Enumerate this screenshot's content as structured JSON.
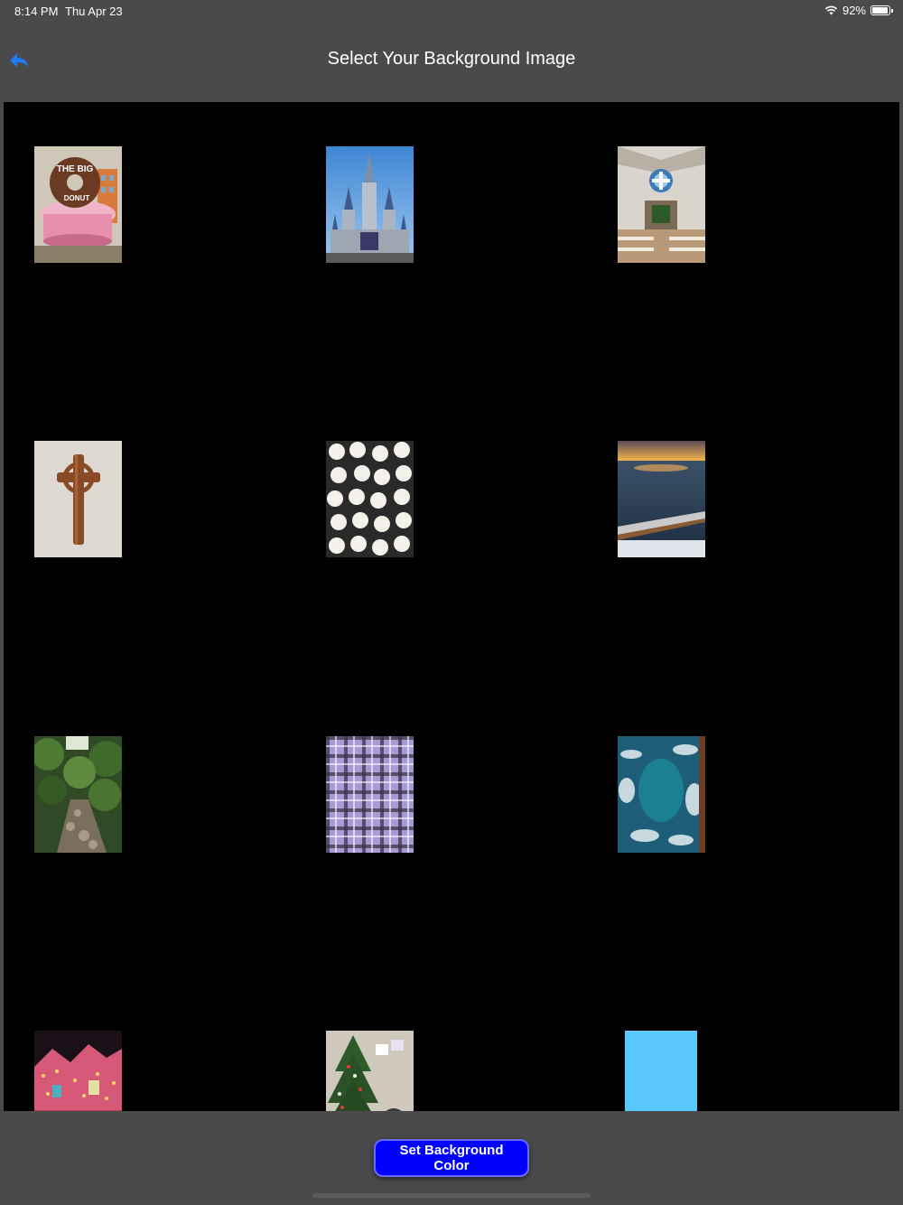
{
  "status_bar": {
    "time": "8:14 PM",
    "date": "Thu Apr 23",
    "battery": "92%",
    "battery_level": 0.92,
    "wifi_icon": "wifi-icon"
  },
  "nav": {
    "title": "Select Your Background Image",
    "back_icon": "back-arrow-icon",
    "accent_color": "#1e7cf2"
  },
  "gallery": {
    "images": [
      {
        "id": "donut",
        "description_icon": "photo-thumbnail"
      },
      {
        "id": "castle"
      },
      {
        "id": "church"
      },
      {
        "id": "cross"
      },
      {
        "id": "flowers"
      },
      {
        "id": "sunset"
      },
      {
        "id": "jungle"
      },
      {
        "id": "plaid"
      },
      {
        "id": "ocean"
      },
      {
        "id": "small-world"
      },
      {
        "id": "tree"
      },
      {
        "id": "sky-swatch"
      }
    ]
  },
  "footer": {
    "set_color_label": "Set Background Color",
    "button_color": "#0000ff"
  }
}
